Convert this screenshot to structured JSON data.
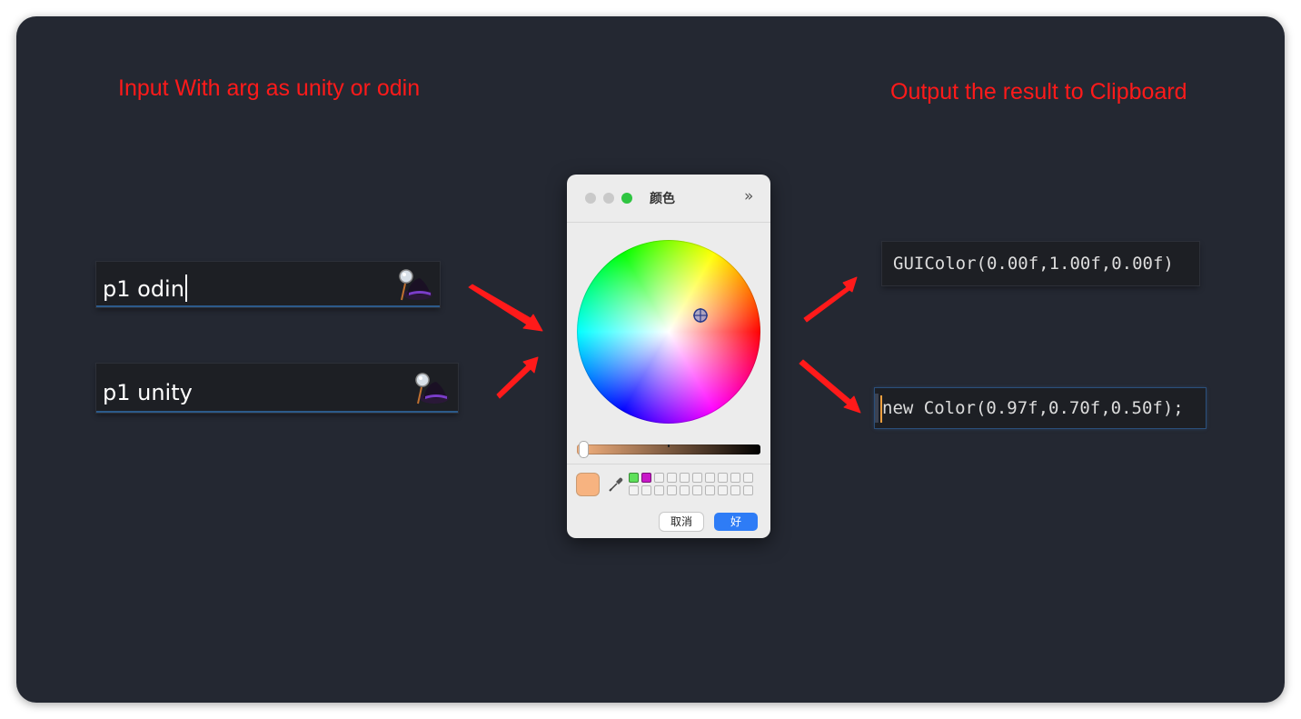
{
  "captions": {
    "input": "Input With arg as unity or odin",
    "output": "Output the result to Clipboard"
  },
  "launchers": [
    {
      "query": "p1 odin",
      "icon": "alfred-hat-icon"
    },
    {
      "query": "p1 unity",
      "icon": "alfred-hat-icon"
    }
  ],
  "color_picker": {
    "title": "颜色",
    "more_icon": "double-chevron-right-icon",
    "selected_color": "#f7b380",
    "recent_swatches": [
      "#5ee05a",
      "#c818c8"
    ],
    "cancel_label": "取消",
    "ok_label": "好"
  },
  "outputs": {
    "odin": "GUIColor(0.00f,1.00f,0.00f)",
    "unity": "new Color(0.97f,0.70f,0.50f);"
  },
  "colors": {
    "background": "#242832",
    "caption": "#ff1a1a",
    "arrow": "#ff1a1a",
    "accent": "#2e7cf6"
  }
}
